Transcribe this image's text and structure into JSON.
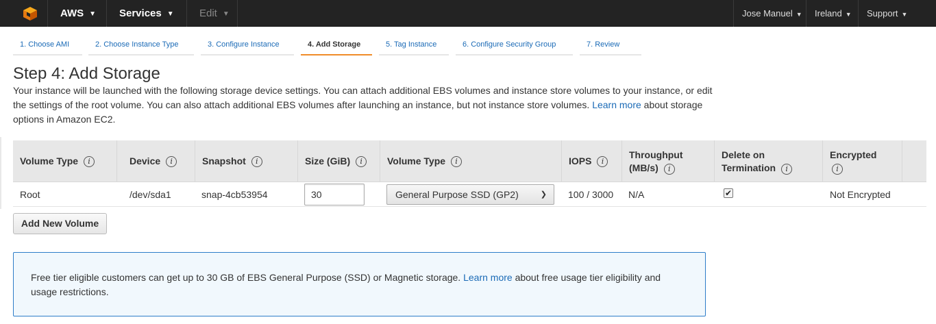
{
  "topnav": {
    "brand": "AWS",
    "services": "Services",
    "edit": "Edit",
    "user": "Jose Manuel",
    "region": "Ireland",
    "support": "Support"
  },
  "wizard_tabs": [
    {
      "label": "1. Choose AMI"
    },
    {
      "label": "2. Choose Instance Type"
    },
    {
      "label": "3. Configure Instance"
    },
    {
      "label": "4. Add Storage"
    },
    {
      "label": "5. Tag Instance"
    },
    {
      "label": "6. Configure Security Group"
    },
    {
      "label": "7. Review"
    }
  ],
  "page": {
    "title": "Step 4: Add Storage",
    "intro_before_link": "Your instance will be launched with the following storage device settings. You can attach additional EBS volumes and instance store volumes to your instance, or edit the settings of the root volume. You can also attach additional EBS volumes after launching an instance, but not instance store volumes.",
    "intro_link": "Learn more",
    "intro_after_link": "about storage options in Amazon EC2."
  },
  "table": {
    "columns": [
      {
        "label": "Volume Type"
      },
      {
        "label": "Device"
      },
      {
        "label": "Snapshot"
      },
      {
        "label": "Size (GiB)"
      },
      {
        "label": "Volume Type"
      },
      {
        "label": "IOPS"
      },
      {
        "label": "Throughput (MB/s)"
      },
      {
        "label": "Delete on Termination"
      },
      {
        "label": "Encrypted"
      }
    ],
    "rows": [
      {
        "volume_type": "Root",
        "device": "/dev/sda1",
        "snapshot": "snap-4cb53954",
        "size": "30",
        "ebs_type": "General Purpose SSD (GP2)",
        "iops": "100 / 3000",
        "throughput": "N/A",
        "delete_on_termination": true,
        "encrypted": "Not Encrypted"
      }
    ]
  },
  "add_volume_label": "Add New Volume",
  "notice": {
    "before_link": "Free tier eligible customers can get up to 30 GB of EBS General Purpose (SSD) or Magnetic storage.",
    "link": "Learn more",
    "after_link": "about free usage tier eligibility and usage restrictions."
  },
  "colors": {
    "topbar": "#232323",
    "accent_tab": "#f08c28",
    "link": "#1a6ab6",
    "notice_border": "#2c7cc8",
    "notice_bg": "#f1f8fd"
  }
}
